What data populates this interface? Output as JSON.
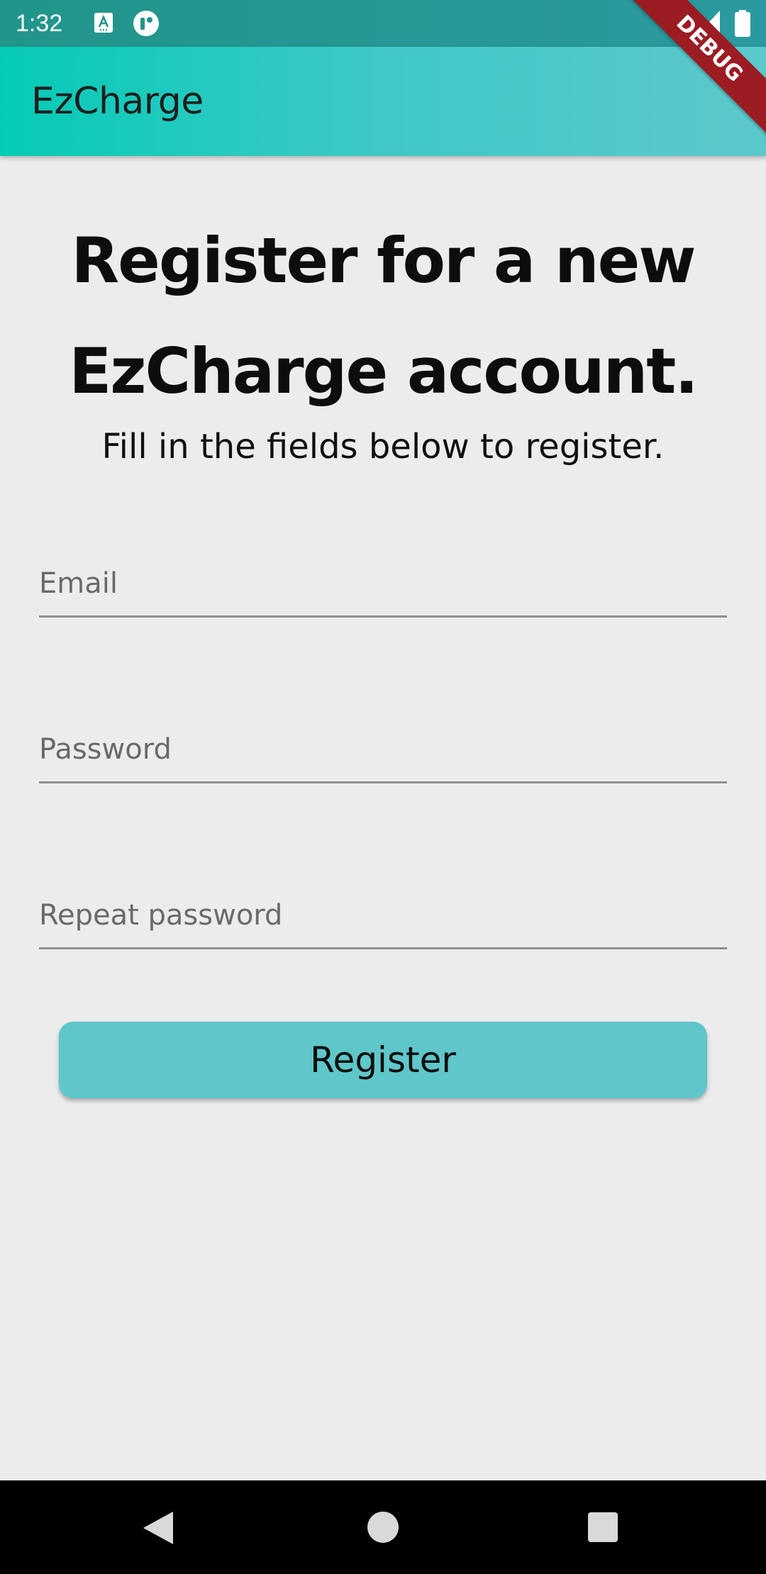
{
  "status_bar": {
    "time": "1:32",
    "icons": [
      "text-a-icon",
      "u-icon",
      "wifi-icon",
      "signal-icon",
      "battery-icon"
    ]
  },
  "app_bar": {
    "title": "EzCharge"
  },
  "debug_banner": "DEBUG",
  "main": {
    "headline": "Register for a new EzCharge account.",
    "subtitle": "Fill in the fields below to register.",
    "fields": {
      "email_label": "Email",
      "password_label": "Password",
      "repeat_password_label": "Repeat password"
    },
    "register_label": "Register"
  },
  "nav_bar": {
    "icons": [
      "back-icon",
      "home-icon",
      "recents-icon"
    ]
  },
  "colors": {
    "app_bar_start": "#05cbb6",
    "app_bar_end": "#5cc8cc",
    "button": "#5fc6c9",
    "background": "#ececec",
    "debug": "#9c1c24"
  }
}
